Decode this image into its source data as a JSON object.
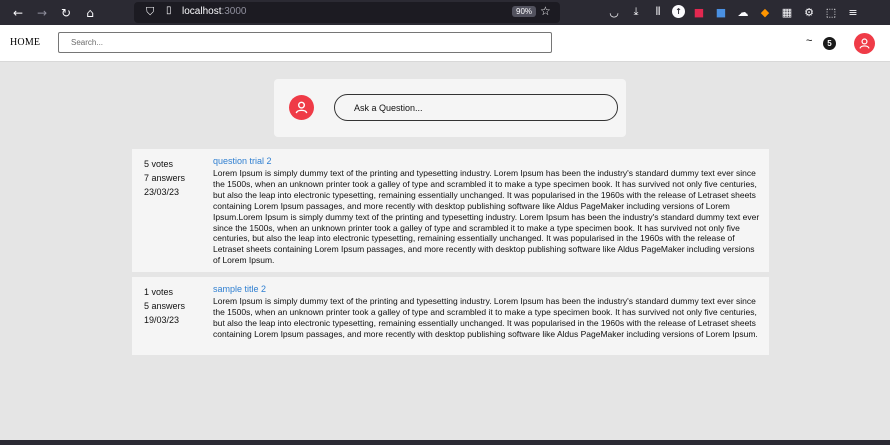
{
  "browser": {
    "url_host": "localhost",
    "url_port": ":3000",
    "zoom": "90%",
    "icons": [
      "back-icon",
      "forward-icon",
      "reload-icon",
      "home-icon",
      "shield-icon",
      "lock-icon",
      "star-icon",
      "pocket-icon",
      "download-icon",
      "library-icon",
      "extension-icon",
      "ublock-icon",
      "container-icon",
      "cloud-icon",
      "metamask-icon",
      "screenshot-icon",
      "settings-icon",
      "extensions-puzzle-icon",
      "menu-icon"
    ]
  },
  "header": {
    "home_label": "HOME",
    "search_placeholder": "Search...",
    "tilde": "~",
    "reputation": "5"
  },
  "ask": {
    "placeholder": "Ask a Question..."
  },
  "questions": [
    {
      "votes": "5 votes",
      "answers": "7 answers",
      "date": "23/03/23",
      "title": "question trial 2",
      "body": "Lorem Ipsum is simply dummy text of the printing and typesetting industry. Lorem Ipsum has been the industry's standard dummy text ever since the 1500s, when an unknown printer took a galley of type and scrambled it to make a type specimen book. It has survived not only five centuries, but also the leap into electronic typesetting, remaining essentially unchanged. It was popularised in the 1960s with the release of Letraset sheets containing Lorem Ipsum passages, and more recently with desktop publishing software like Aldus PageMaker including versions of Lorem Ipsum.Lorem Ipsum is simply dummy text of the printing and typesetting industry. Lorem Ipsum has been the industry's standard dummy text ever since the 1500s, when an unknown printer took a galley of type and scrambled it to make a type specimen book. It has survived not only five centuries, but also the leap into electronic typesetting, remaining essentially unchanged. It was popularised in the 1960s with the release of Letraset sheets containing Lorem Ipsum passages, and more recently with desktop publishing software like Aldus PageMaker including versions of Lorem Ipsum."
    },
    {
      "votes": "1 votes",
      "answers": "5 answers",
      "date": "19/03/23",
      "title": "sample title 2",
      "body": "Lorem Ipsum is simply dummy text of the printing and typesetting industry. Lorem Ipsum has been the industry's standard dummy text ever since the 1500s, when an unknown printer took a galley of type and scrambled it to make a type specimen book. It has survived not only five centuries, but also the leap into electronic typesetting, remaining essentially unchanged. It was popularised in the 1960s with the release of Letraset sheets containing Lorem Ipsum passages, and more recently with desktop publishing software like Aldus PageMaker including versions of Lorem Ipsum."
    }
  ],
  "colors": {
    "accent": "#ef3b47",
    "link": "#2f7fd1",
    "page_bg": "#e5e5e5",
    "card_bg": "#f5f5f5"
  }
}
